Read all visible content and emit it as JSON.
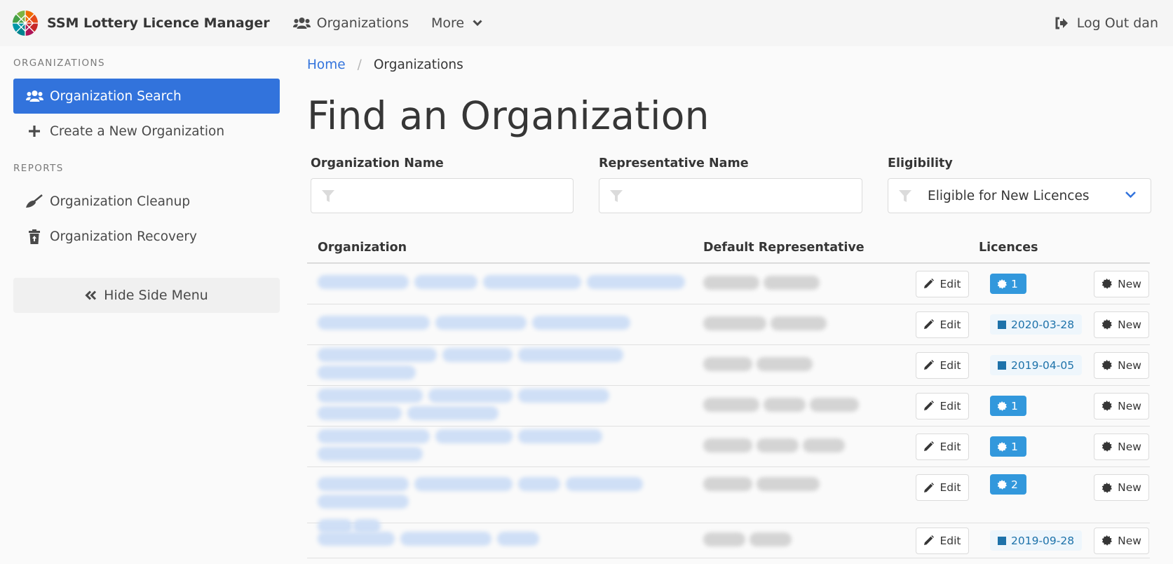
{
  "navbar": {
    "brand": "SSM Lottery Licence Manager",
    "organizations": "Organizations",
    "more": "More",
    "logout": "Log Out dan"
  },
  "sidebar": {
    "section_orgs": "Organizations",
    "items_orgs": [
      {
        "label": "Organization Search",
        "icon": "users-icon",
        "active": true
      },
      {
        "label": "Create a New Organization",
        "icon": "plus-icon",
        "active": false
      }
    ],
    "section_reports": "Reports",
    "items_reports": [
      {
        "label": "Organization Cleanup",
        "icon": "broom-icon"
      },
      {
        "label": "Organization Recovery",
        "icon": "trash-restore-icon"
      }
    ],
    "hide_menu": "Hide Side Menu"
  },
  "breadcrumb": {
    "home": "Home",
    "separator": "/",
    "current": "Organizations"
  },
  "page_title": "Find an Organization",
  "filters": {
    "org_name_label": "Organization Name",
    "org_name_value": "",
    "rep_name_label": "Representative Name",
    "rep_name_value": "",
    "eligibility_label": "Eligibility",
    "eligibility_value": "Eligible for New Licences"
  },
  "table": {
    "headers": {
      "organization": "Organization",
      "representative": "Default Representative",
      "licences": "Licences"
    },
    "edit_label": "Edit",
    "new_label": "New",
    "rows": [
      {
        "organization": "[redacted]",
        "representative": "[redacted]",
        "licence_type": "count",
        "licence": "1"
      },
      {
        "organization": "[redacted]",
        "representative": "[redacted]",
        "licence_type": "date",
        "licence": "2020-03-28"
      },
      {
        "organization": "[redacted]",
        "representative": "[redacted]",
        "licence_type": "date",
        "licence": "2019-04-05"
      },
      {
        "organization": "[redacted]",
        "representative": "[redacted]",
        "licence_type": "count",
        "licence": "1"
      },
      {
        "organization": "[redacted]",
        "representative": "[redacted]",
        "licence_type": "count",
        "licence": "1"
      },
      {
        "organization": "[redacted]",
        "representative": "[redacted]",
        "licence_type": "count",
        "licence": "2"
      },
      {
        "organization": "[redacted]",
        "representative": "[redacted]",
        "licence_type": "date",
        "licence": "2019-09-28"
      }
    ]
  },
  "colors": {
    "primary": "#3273dc",
    "info": "#3298dc",
    "info_light": "#eef6fc",
    "info_dark": "#1d72aa",
    "text": "#363636"
  }
}
